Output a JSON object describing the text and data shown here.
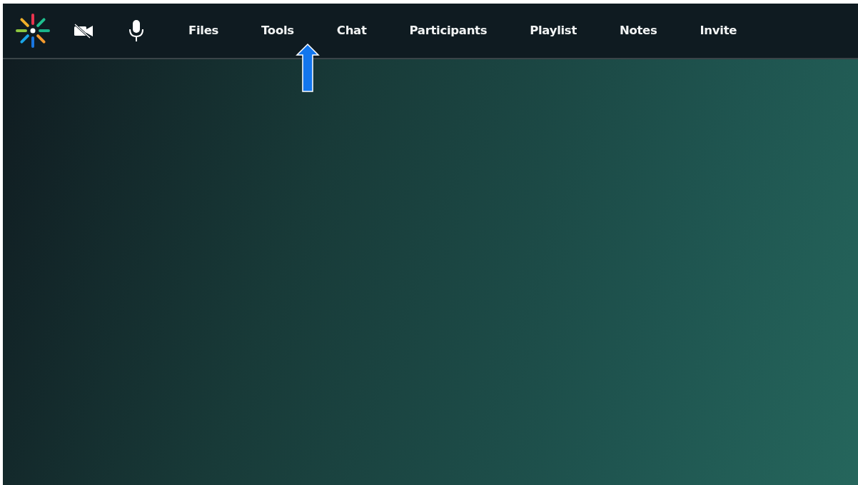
{
  "toolbar": {
    "controls": [
      {
        "kind": "logo"
      },
      {
        "kind": "camera-off"
      },
      {
        "kind": "microphone"
      }
    ],
    "menu": [
      {
        "label": "Files"
      },
      {
        "label": "Tools"
      },
      {
        "label": "Chat"
      },
      {
        "label": "Participants"
      },
      {
        "label": "Playlist"
      },
      {
        "label": "Notes"
      },
      {
        "label": "Invite"
      }
    ]
  }
}
